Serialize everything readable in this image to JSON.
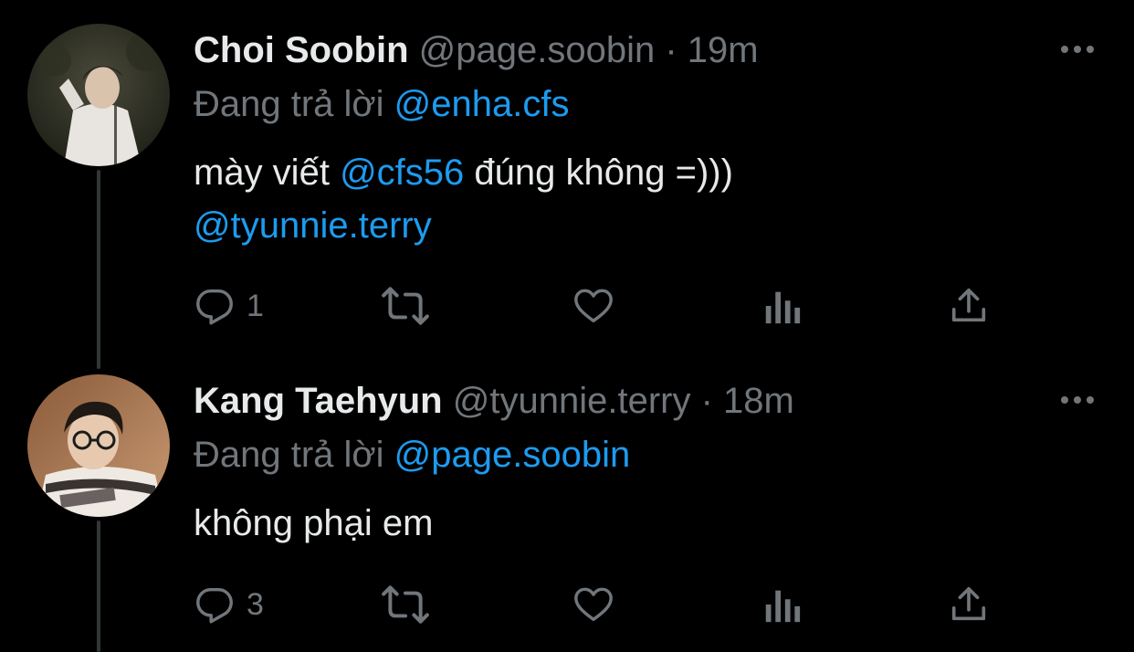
{
  "tweets": [
    {
      "name": "Choi Soobin",
      "handle": "@page.soobin",
      "separator": "·",
      "time": "19m",
      "replying_prefix": "Đang trả lời",
      "replying_to": "@enha.cfs",
      "body_line1_prefix": "mày viết",
      "body_mention1": "@cfs56",
      "body_line1_suffix": "đúng không =)))",
      "body_mention2": "@tyunnie.terry",
      "reply_count": "1",
      "avatar_icon": "avatar-photo"
    },
    {
      "name": "Kang Taehyun",
      "handle": "@tyunnie.terry",
      "separator": "·",
      "time": "18m",
      "replying_prefix": "Đang trả lời",
      "replying_to": "@page.soobin",
      "body": "không phại em",
      "reply_count": "3",
      "avatar_icon": "avatar-photo"
    }
  ],
  "icons": {
    "reply": "reply-icon",
    "retweet": "retweet-icon",
    "like": "heart-icon",
    "views": "views-icon",
    "share": "share-icon",
    "more": "more-icon"
  },
  "colors": {
    "background": "#000000",
    "text": "#e7e9ea",
    "secondary": "#71767b",
    "mention": "#1d9bf0",
    "thread_line": "#333639"
  }
}
